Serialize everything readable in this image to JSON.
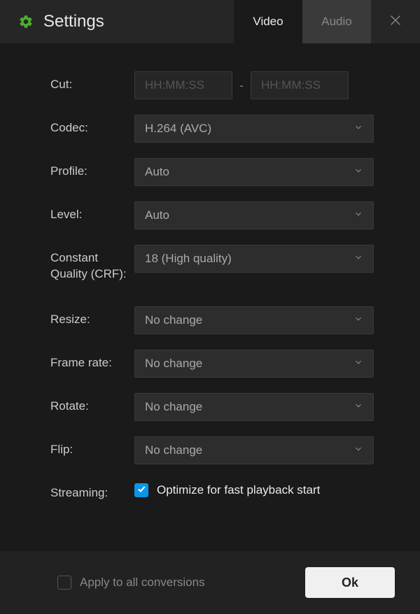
{
  "header": {
    "title": "Settings",
    "tabs": {
      "video": "Video",
      "audio": "Audio"
    }
  },
  "rows": {
    "cut": {
      "label": "Cut:",
      "from_placeholder": "HH:MM:SS",
      "to_placeholder": "HH:MM:SS",
      "dash": "-"
    },
    "codec": {
      "label": "Codec:",
      "value": "H.264 (AVC)"
    },
    "profile": {
      "label": "Profile:",
      "value": "Auto"
    },
    "level": {
      "label": "Level:",
      "value": "Auto"
    },
    "crf": {
      "label": "Constant Quality (CRF):",
      "value": "18 (High quality)"
    },
    "resize": {
      "label": "Resize:",
      "value": "No change"
    },
    "framerate": {
      "label": "Frame rate:",
      "value": "No change"
    },
    "rotate": {
      "label": "Rotate:",
      "value": "No change"
    },
    "flip": {
      "label": "Flip:",
      "value": "No change"
    },
    "streaming": {
      "label": "Streaming:",
      "check_label": "Optimize for fast playback start",
      "checked": true
    }
  },
  "footer": {
    "apply_label": "Apply to all conversions",
    "apply_checked": false,
    "ok_label": "Ok"
  }
}
